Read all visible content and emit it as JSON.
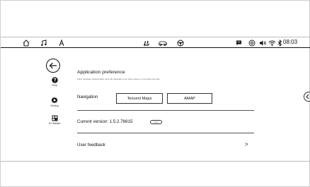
{
  "statusbar": {
    "left_icons": [
      "home-icon",
      "music-icon",
      "navigation-icon"
    ],
    "center_icons": [
      "seat-icon",
      "car-icon",
      "steering-wheel-icon"
    ],
    "right_icons": [
      "message-icon",
      "link-icon",
      "volume-icon",
      "wifi-icon",
      "bluetooth-icon"
    ],
    "time": "08:03"
  },
  "sidebar": {
    "items": [
      {
        "label": "Help",
        "icon": "help-icon"
      },
      {
        "label": "Setting",
        "icon": "gear-icon"
      },
      {
        "label": "JD Wallian",
        "icon": "jd-wallian-icon"
      }
    ]
  },
  "main": {
    "title": "Application preference",
    "description": "Voice assistant preferentially uses the application you have chosen to complete the task",
    "navigation_label": "Navigation",
    "navigation_options": [
      "Tencent Maps",
      "AMAP"
    ],
    "version_label": "Current version: 1.5.2.76615",
    "version_badge": "new",
    "feedback_label": "User feedback",
    "feedback_chevron": ">"
  }
}
